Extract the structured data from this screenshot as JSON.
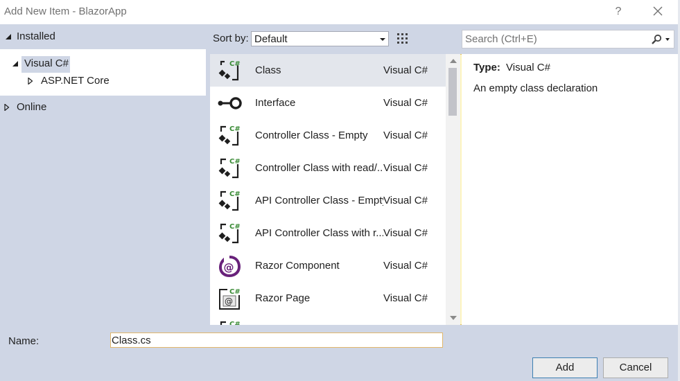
{
  "window": {
    "title": "Add New Item - BlazorApp",
    "help_label": "?"
  },
  "tree": [
    {
      "label": "Installed",
      "expanded": true
    },
    {
      "label": "Visual C#",
      "expanded": true,
      "selected": true
    },
    {
      "label": "ASP.NET Core",
      "expanded": false
    },
    {
      "label": "Online",
      "expanded": false
    }
  ],
  "toolbar": {
    "sort_label": "Sort by:",
    "sort_value": "Default"
  },
  "search": {
    "placeholder": "Search (Ctrl+E)"
  },
  "templates": [
    {
      "name": "Class",
      "language": "Visual C#",
      "icon": "class-icon",
      "selected": true
    },
    {
      "name": "Interface",
      "language": "Visual C#",
      "icon": "interface-icon"
    },
    {
      "name": "Controller Class - Empty",
      "language": "Visual C#",
      "icon": "controller-icon"
    },
    {
      "name": "Controller Class with read/...",
      "language": "Visual C#",
      "icon": "controller-icon"
    },
    {
      "name": "API Controller Class - Empty",
      "language": "Visual C#",
      "icon": "controller-icon"
    },
    {
      "name": "API Controller Class with r...",
      "language": "Visual C#",
      "icon": "controller-icon"
    },
    {
      "name": "Razor Component",
      "language": "Visual C#",
      "icon": "razor-component-icon"
    },
    {
      "name": "Razor Page",
      "language": "Visual C#",
      "icon": "razor-page-icon"
    },
    {
      "name": "",
      "language": "",
      "icon": "class-icon"
    }
  ],
  "details": {
    "type_label": "Type:",
    "type_value": "Visual C#",
    "description": "An empty class declaration"
  },
  "name_field": {
    "label": "Name:",
    "value": "Class.cs"
  },
  "buttons": {
    "add": "Add",
    "cancel": "Cancel"
  },
  "colors": {
    "dialog_bg": "#cfd6e5",
    "csharp_green": "#388a34",
    "razor_purple": "#68217a",
    "accent_border": "#3c7fb1"
  }
}
